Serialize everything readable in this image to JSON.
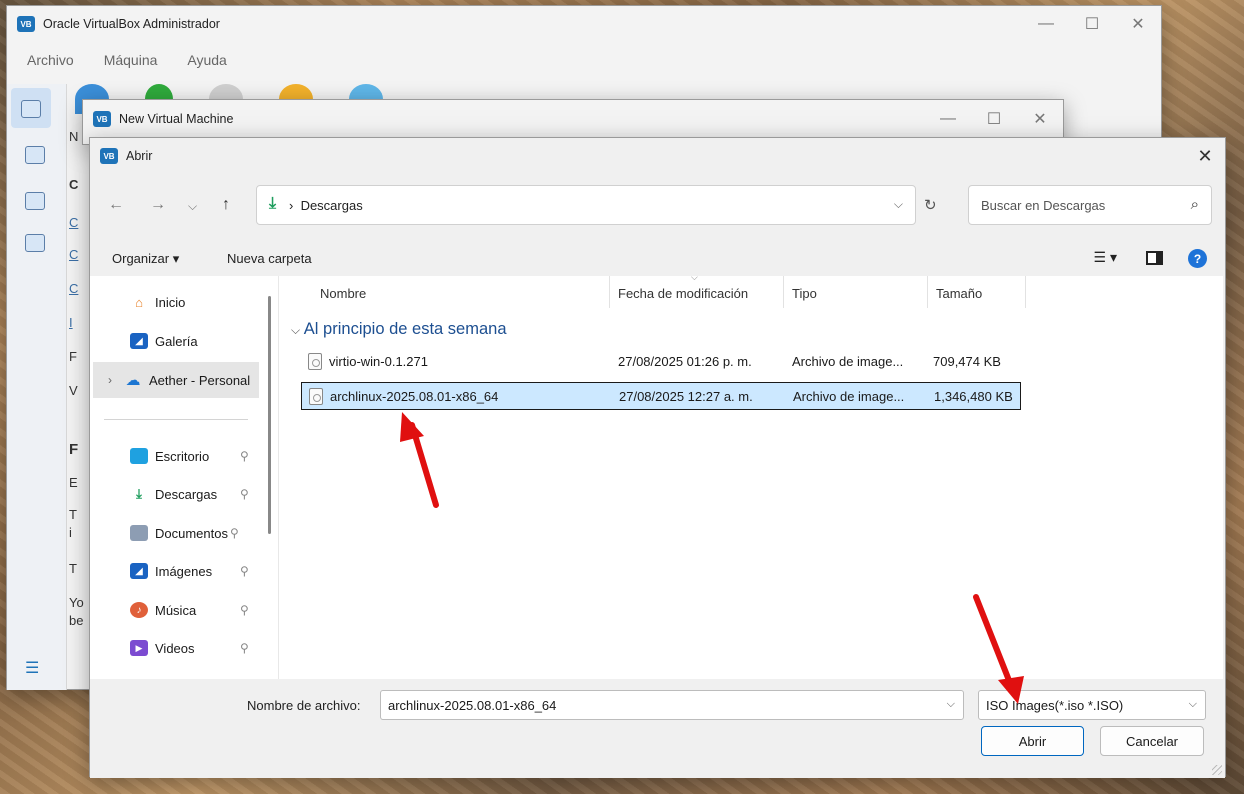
{
  "main_window": {
    "title": "Oracle VirtualBox Administrador",
    "menu": [
      "Archivo",
      "Máquina",
      "Ayuda"
    ],
    "behind_letters": [
      "N",
      "C",
      "C",
      "C",
      "C",
      "I",
      "F",
      "V",
      "F",
      "E",
      "T",
      "i",
      "T",
      "Yo",
      "be"
    ]
  },
  "nvm_window": {
    "title": "New Virtual Machine"
  },
  "dialog": {
    "title": "Abrir",
    "address": {
      "path": "Descargas"
    },
    "search": {
      "placeholder": "Buscar en Descargas"
    },
    "toolbar": {
      "organize": "Organizar ▾",
      "new_folder": "Nueva carpeta"
    },
    "nav_pane": [
      {
        "label": "Inicio",
        "icon": "home-icon"
      },
      {
        "label": "Galería",
        "icon": "gallery-icon"
      },
      {
        "label": "Aether - Personal",
        "icon": "onedrive-cloud-icon"
      },
      {
        "label": "Escritorio",
        "icon": "desktop-icon"
      },
      {
        "label": "Descargas",
        "icon": "download-icon"
      },
      {
        "label": "Documentos",
        "icon": "documents-icon"
      },
      {
        "label": "Imágenes",
        "icon": "pictures-icon"
      },
      {
        "label": "Música",
        "icon": "music-icon"
      },
      {
        "label": "Videos",
        "icon": "videos-icon"
      }
    ],
    "columns": [
      "Nombre",
      "Fecha de modificación",
      "Tipo",
      "Tamaño"
    ],
    "group": "Al principio de esta semana",
    "files": [
      {
        "name": "virtio-win-0.1.271",
        "date": "27/08/2025 01:26 p. m.",
        "type": "Archivo de image...",
        "size": "709,474 KB",
        "selected": false
      },
      {
        "name": "archlinux-2025.08.01-x86_64",
        "date": "27/08/2025 12:27 a. m.",
        "type": "Archivo de image...",
        "size": "1,346,480 KB",
        "selected": true
      }
    ],
    "filename_label": "Nombre de archivo:",
    "filename_value": "archlinux-2025.08.01-x86_64",
    "filetype_value": "ISO Images(*.iso *.ISO)",
    "open_button": "Abrir",
    "cancel_button": "Cancelar"
  },
  "colors": {
    "selection": "#cce8ff",
    "accent": "#0067c0",
    "group_header": "#1d4f91",
    "arrow": "#e01010"
  }
}
